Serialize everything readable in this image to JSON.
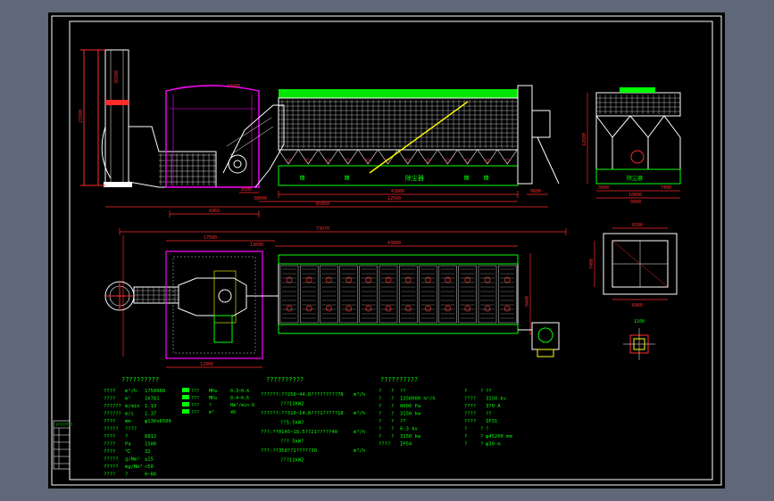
{
  "colors": {
    "background": "#5e6878",
    "sheet": "#000000",
    "frame": "#ffffff",
    "text": "#00ff00",
    "dimension": "#ff2a2a",
    "structure": "#ff00ff",
    "accent": "#ffff00",
    "equipment": "#ffffff",
    "cyan": "#00ffff"
  },
  "elevation": {
    "stack_height": "30200",
    "stack_dim": "23980",
    "bag_label": "除尘器",
    "bag_icon_a": "⊠",
    "bag_icon_b": "⊠",
    "bag_icon_c": "⊠",
    "bag_icon_d": "⊠",
    "dim_1": "43800",
    "dim_2": "12560",
    "dim_3": "38600",
    "dim_4": "9600",
    "dim_5": "65050",
    "dim_6": "9500",
    "dim_7": "6960",
    "dim_8": "23400"
  },
  "side_view": {
    "bag_label": "除尘器",
    "dim_height": "12600",
    "dim_bottom": "10800",
    "dim_left": "3000",
    "dim_right": "7400",
    "dim_total": "9000"
  },
  "plan": {
    "dim_total": "73070",
    "dim_left": "17500",
    "dim_right": "43800",
    "dim_mid": "13600",
    "dim_bottom": "12800",
    "dim_width": "9400"
  },
  "detail": {
    "dim_top": "8500",
    "dim_side": "7400",
    "dim_bottom": "6900",
    "small_label": "1100"
  },
  "table1": {
    "title": "??????????",
    "rows": [
      [
        "????",
        "m³/h",
        "1750000"
      ],
      [
        "????",
        "m²",
        "16781"
      ],
      [
        "??????",
        "m/min",
        "1.13"
      ],
      [
        "??????",
        "m/s",
        "1.37"
      ],
      [
        "????",
        "mm",
        "φ130x6500"
      ],
      [
        "?????",
        "????",
        ""
      ],
      [
        "????",
        "?",
        "6812"
      ],
      [
        "????",
        "Pa",
        "1500"
      ],
      [
        "????",
        "℃",
        "32"
      ],
      [
        "?????",
        "g/Nm³",
        "≤15"
      ],
      [
        "?????",
        "mg/Nm³",
        "<50"
      ],
      [
        "????",
        "?",
        "0~80"
      ]
    ],
    "sub_rows": [
      [
        "???",
        "MPa",
        "0.3~0.4"
      ],
      [
        "???",
        "MPa",
        "0.4~0.6"
      ],
      [
        "???",
        "?",
        "Nm³/min 6"
      ],
      [
        "???",
        "m²",
        "40"
      ]
    ]
  },
  "table2": {
    "title": "??????????",
    "lines": [
      [
        "??????:??250~44.8?????????78",
        "m³/h"
      ],
      [
        "???11KW2",
        ""
      ],
      [
        "??????:??310~14.8???1?????18",
        "m³/h"
      ],
      [
        "??5.5kW?",
        ""
      ],
      [
        "???:??0145~18.5??21?????40",
        "m³/h"
      ],
      [
        "??? 5kW?",
        ""
      ],
      [
        "???:??350??1?????30",
        "m³/h"
      ],
      [
        "???11kW2",
        ""
      ]
    ]
  },
  "table3": {
    "title": "??????????",
    "left": [
      [
        "?",
        "?",
        "??"
      ],
      [
        "?",
        "?",
        "1350000 m³/h"
      ],
      [
        "?",
        "?",
        "8000  Pa"
      ],
      [
        "?",
        "?",
        "3150  kw"
      ],
      [
        "?",
        "?",
        "??"
      ],
      [
        "?",
        "?",
        "6.3   kv"
      ],
      [
        "?",
        "?",
        "3150  kw"
      ],
      [
        "????",
        "",
        "IP54"
      ]
    ],
    "right": [
      [
        "?",
        "?",
        "??"
      ],
      [
        "????",
        "",
        "3150  kv"
      ],
      [
        "????",
        "",
        "370   A"
      ],
      [
        "????",
        "",
        "??"
      ],
      [
        "????",
        "",
        "IP31"
      ],
      [
        "?",
        "?",
        "?"
      ],
      [
        "?",
        "?",
        "φ45200  mm"
      ],
      [
        "?",
        "?",
        "φ30    m"
      ]
    ]
  },
  "title_block": {
    "label": "????????"
  }
}
